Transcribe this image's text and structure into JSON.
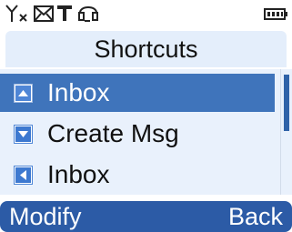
{
  "status_bar": {
    "icons": [
      "no-signal-icon",
      "message-icon",
      "t-network-icon",
      "headset-icon",
      "battery-icon"
    ]
  },
  "header": {
    "title": "Shortcuts"
  },
  "menu": {
    "items": [
      {
        "label": "Inbox",
        "icon": "inbox-icon",
        "selected": true
      },
      {
        "label": "Create Msg",
        "icon": "create-message-icon",
        "selected": false
      },
      {
        "label": "Inbox",
        "icon": "inbox-icon",
        "selected": false
      }
    ]
  },
  "softkeys": {
    "left": "Modify",
    "right": "Back"
  },
  "colors": {
    "selection": "#3f74bb",
    "softkey_bar": "#2c5ba6",
    "list_background": "#e9f1fc"
  }
}
